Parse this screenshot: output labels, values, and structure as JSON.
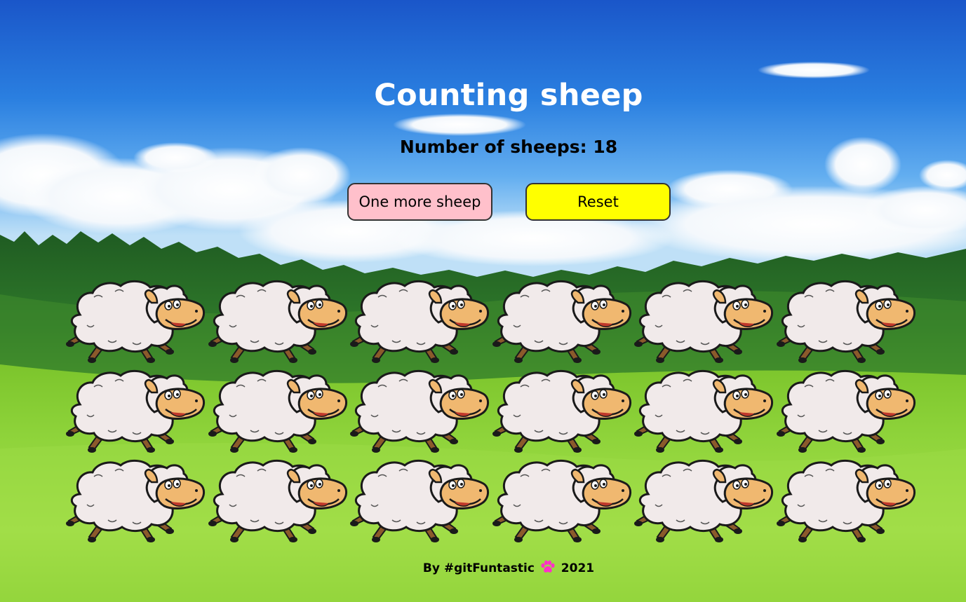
{
  "title": "Counting sheep",
  "counter": {
    "label": "Number of sheeps:",
    "value": 18,
    "text": "Number of sheeps: 18"
  },
  "buttons": {
    "more_label": "One more sheep",
    "reset_label": "Reset"
  },
  "footer": {
    "prefix": "By #gitFuntastic",
    "icon": "paw-icon",
    "year": "2021"
  },
  "colors": {
    "more_button": "#ffc0cb",
    "reset_button": "#ffff00",
    "paw": "#ff2fc8",
    "title": "#ffffff"
  },
  "flock": {
    "count": 18,
    "rows": 3,
    "per_row": 6,
    "icon": "sheep-icon"
  }
}
